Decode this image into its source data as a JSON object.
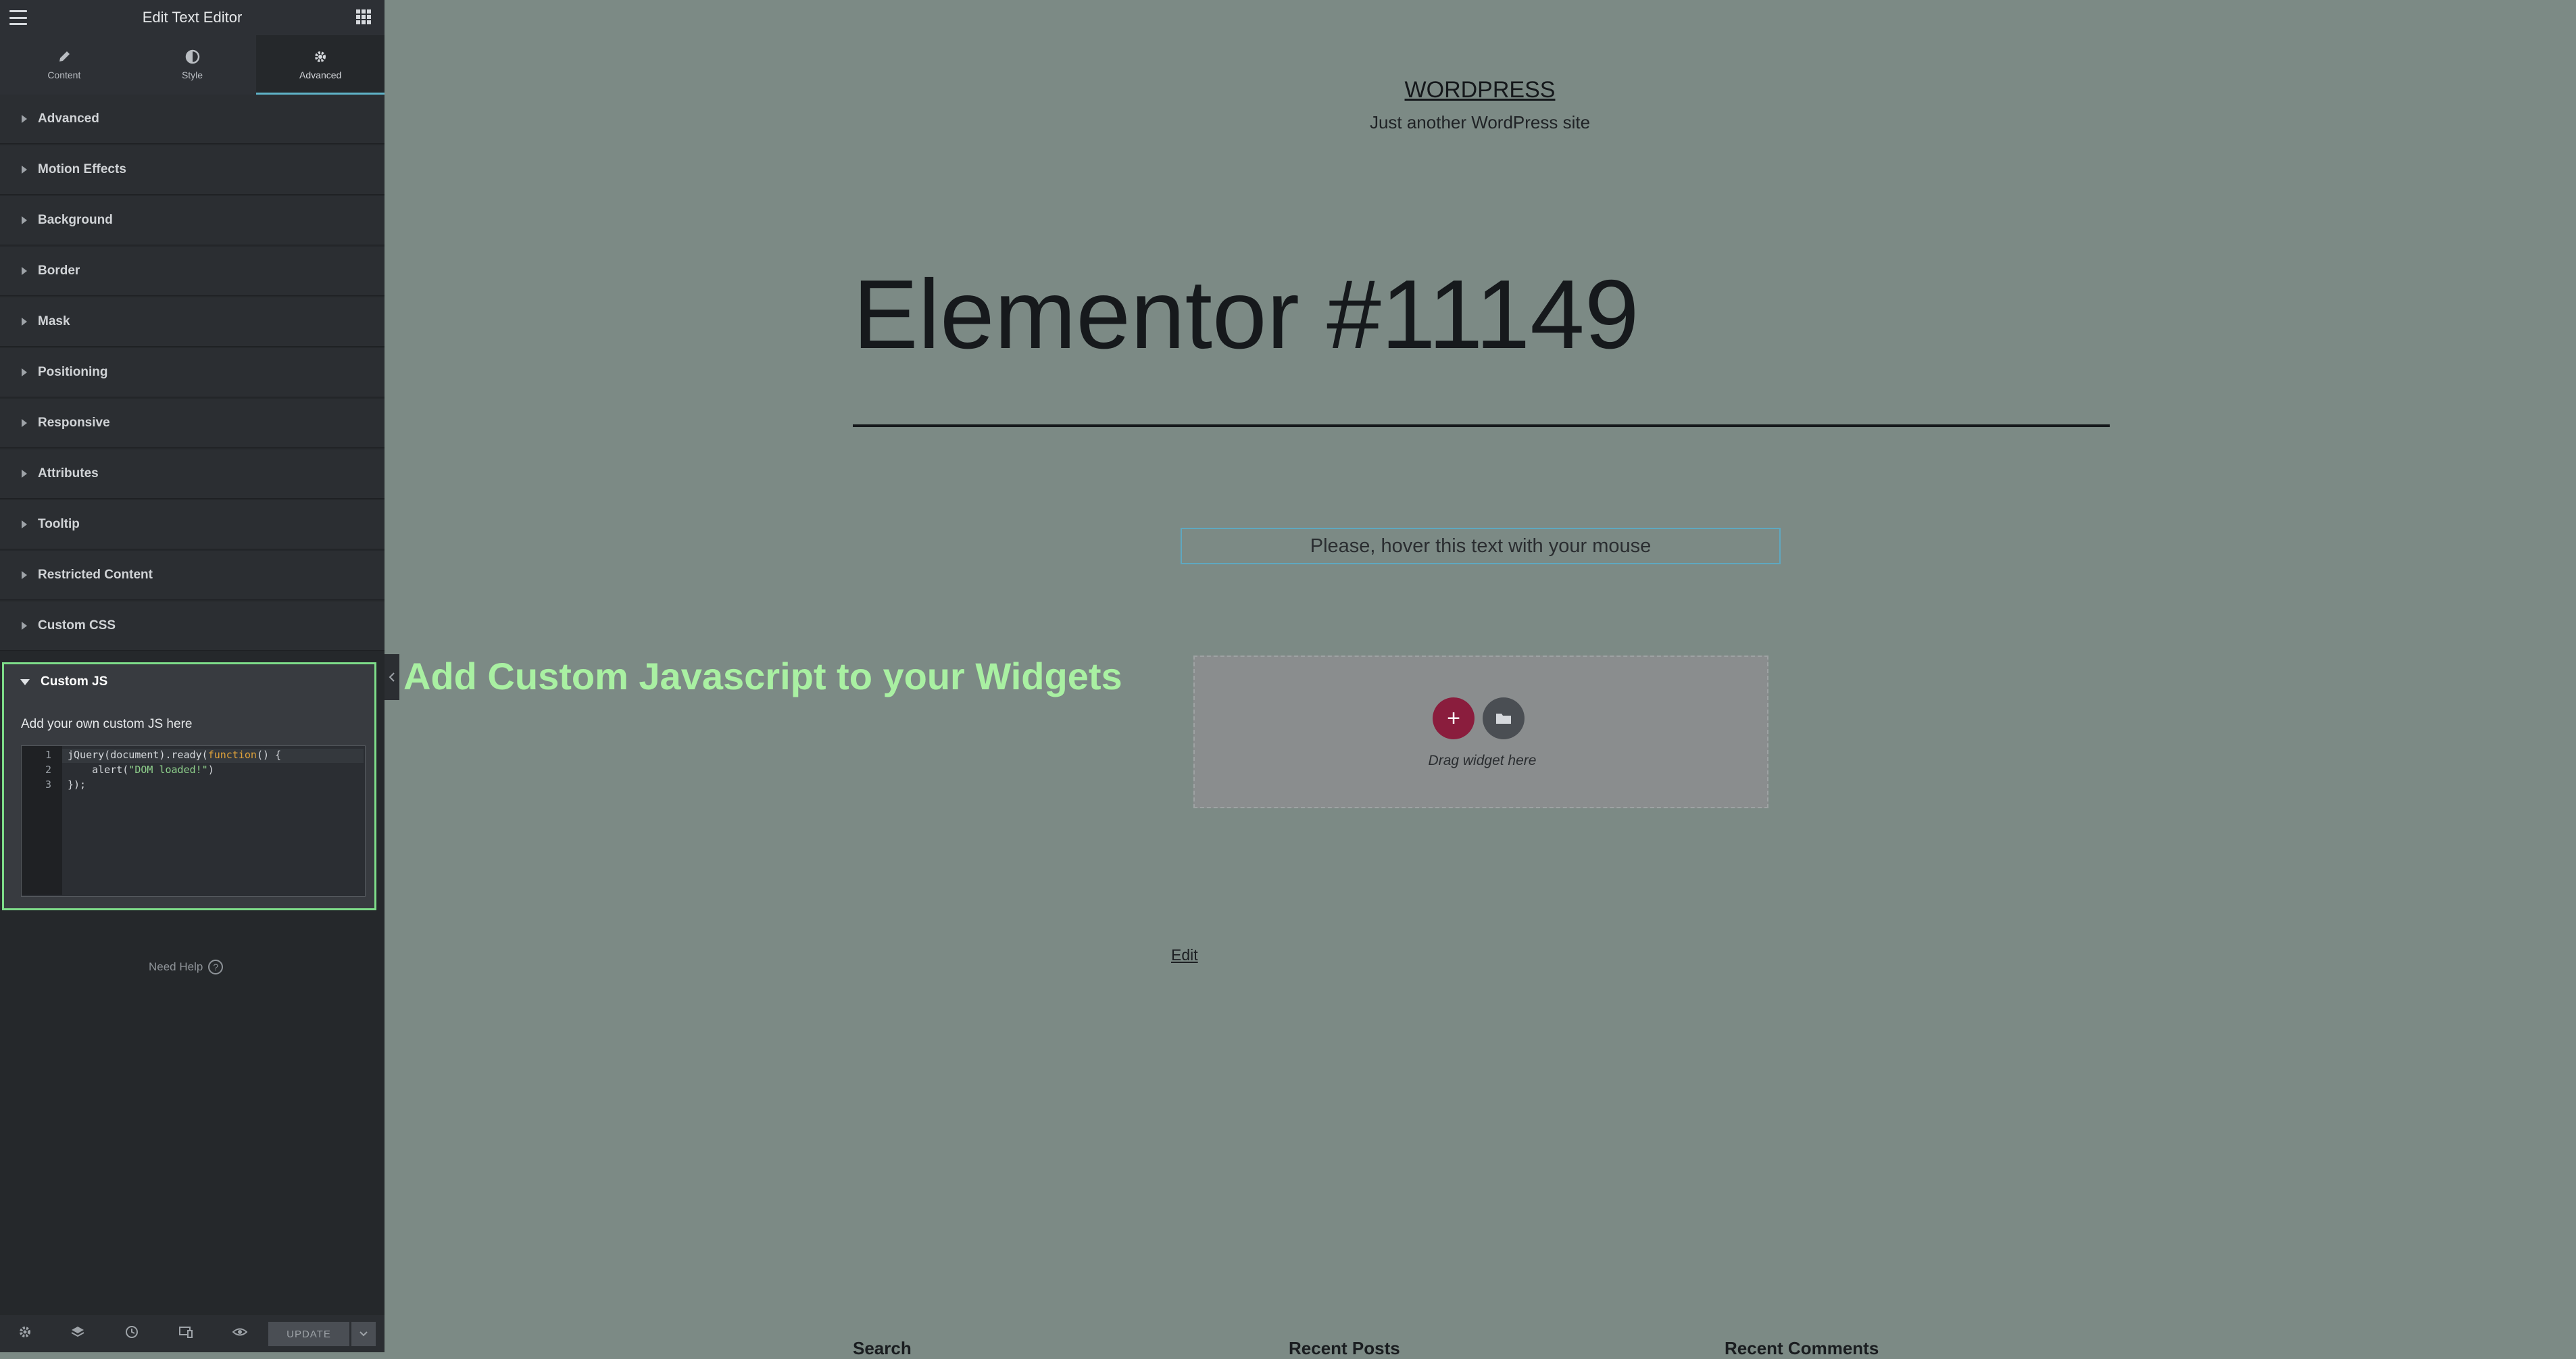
{
  "panel": {
    "title": "Edit Text Editor",
    "tabs": [
      {
        "label": "Content",
        "icon": "pencil-icon"
      },
      {
        "label": "Style",
        "icon": "half-circle-icon"
      },
      {
        "label": "Advanced",
        "icon": "gear-icon"
      }
    ],
    "active_tab": "Advanced",
    "sections": [
      {
        "label": "Advanced"
      },
      {
        "label": "Motion Effects"
      },
      {
        "label": "Background"
      },
      {
        "label": "Border"
      },
      {
        "label": "Mask"
      },
      {
        "label": "Positioning"
      },
      {
        "label": "Responsive"
      },
      {
        "label": "Attributes"
      },
      {
        "label": "Tooltip"
      },
      {
        "label": "Restricted Content"
      },
      {
        "label": "Custom CSS"
      }
    ],
    "custom_js": {
      "title": "Custom JS",
      "description": "Add your own custom JS here",
      "code_lines": [
        {
          "num": "1",
          "pre": "jQuery(document).ready(",
          "kw": "function",
          "post": "() {"
        },
        {
          "num": "2",
          "pre": "    alert(",
          "str": "\"DOM loaded!\"",
          "post": ")"
        },
        {
          "num": "3",
          "pre": "});"
        }
      ]
    },
    "need_help": "Need Help",
    "help_symbol": "?",
    "footer": {
      "update_label": "UPDATE",
      "icons": [
        "settings-icon",
        "layers-icon",
        "history-icon",
        "responsive-icon",
        "preview-eye-icon"
      ]
    }
  },
  "annotation": {
    "text": "Add Custom Javascript to your Widgets",
    "color": "#a9f0a2"
  },
  "canvas": {
    "site_title": "WORDPRESS",
    "site_tagline": "Just another WordPress site",
    "page_title": "Elementor #11149",
    "hover_text": "Please, hover this text with your mouse",
    "drag_widget": "Drag widget here",
    "add_symbol": "+",
    "edit_link": "Edit",
    "footer_widgets": [
      "Search",
      "Recent Posts",
      "Recent Comments"
    ]
  },
  "colors": {
    "panel_bg": "#25282b",
    "canvas_bg": "#7c8a85",
    "accent": "#5fb3c8",
    "add_button": "#8a1d3d",
    "highlight_border": "#7edc89"
  }
}
